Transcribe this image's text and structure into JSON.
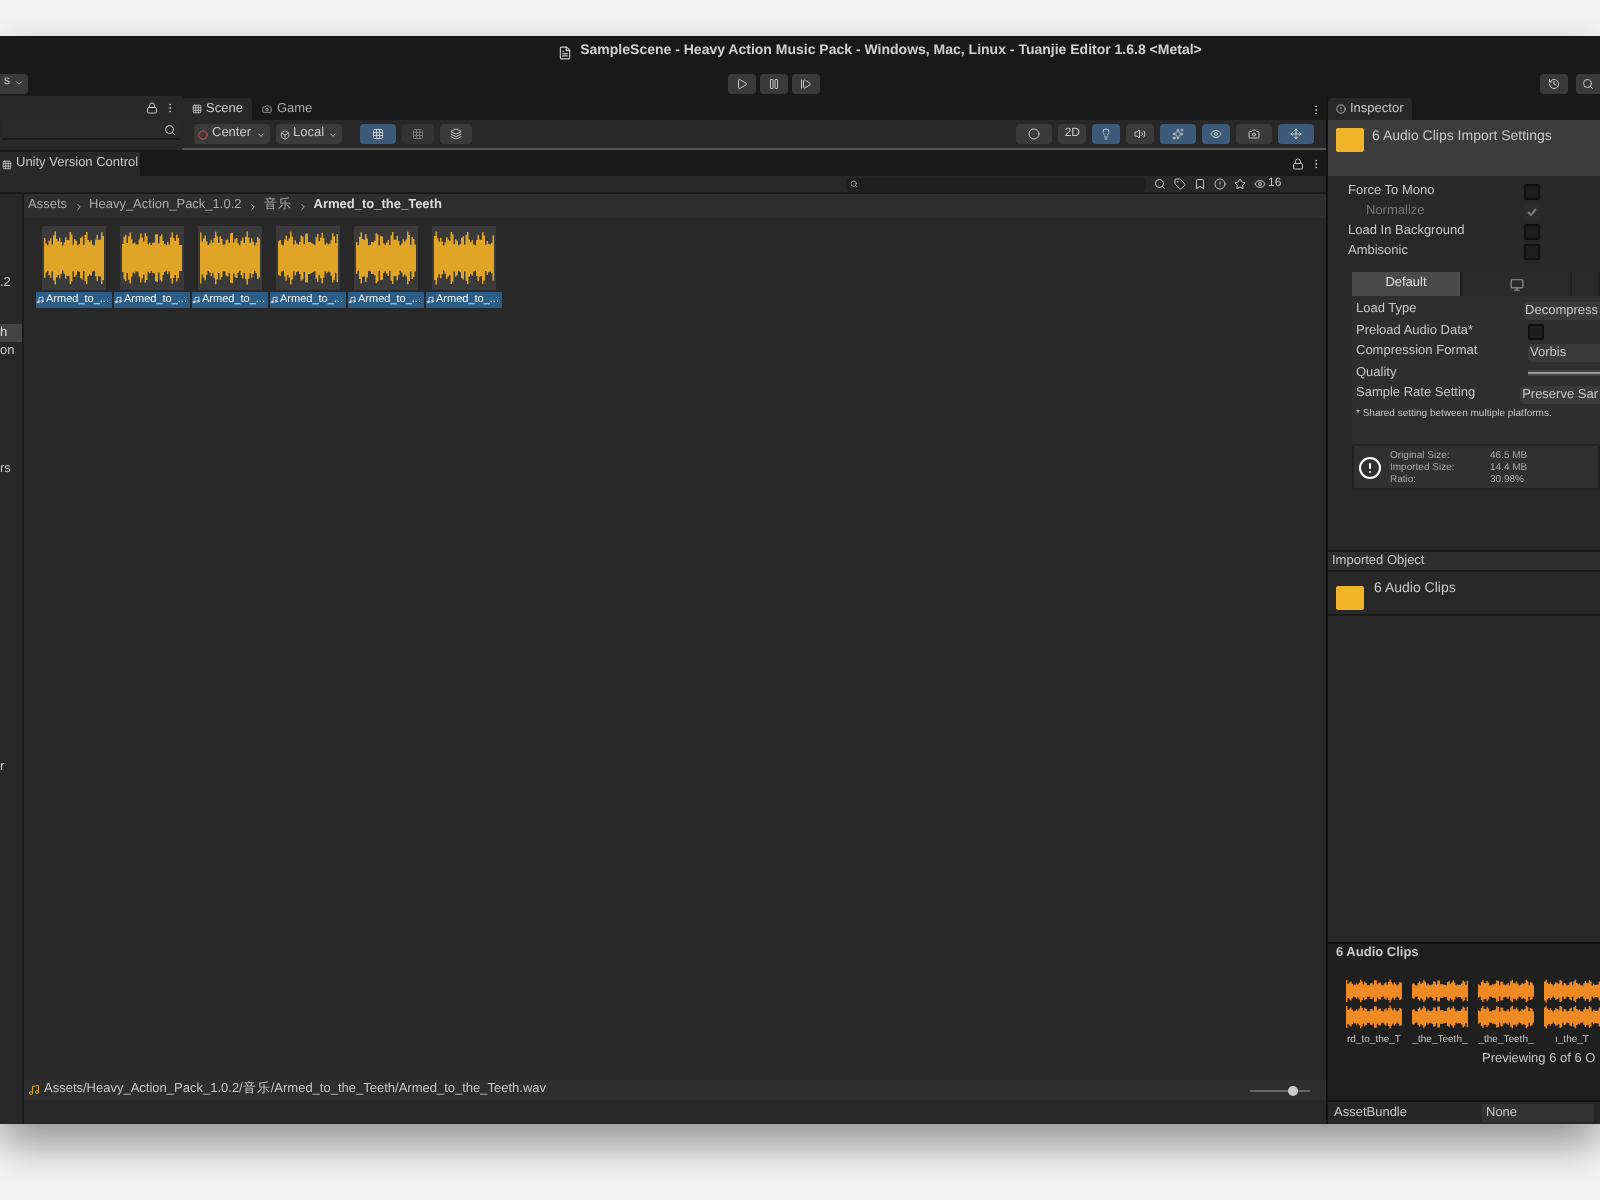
{
  "title_bar": {
    "title": "SampleScene - Heavy Action Music Pack - Windows, Mac, Linux - Tuanjie Editor 1.6.8 <Metal>"
  },
  "toolbar": {
    "layers_dropdown": "s"
  },
  "scene_view": {
    "tabs": [
      {
        "label": "Scene",
        "selected": true
      },
      {
        "label": "Game",
        "selected": false
      }
    ],
    "pivot_buttons": [
      "Center",
      "Local"
    ],
    "mode_2d": "2D"
  },
  "project": {
    "tab": "Unity Version Control",
    "hidden_count": "16",
    "folder_tree": [
      {
        "label": ".2",
        "selected": false
      },
      {
        "label": "h",
        "selected": true
      },
      {
        "label": "on",
        "selected": false
      },
      {
        "label": "rs",
        "selected": false
      },
      {
        "label": "r",
        "selected": false
      }
    ],
    "breadcrumb": [
      {
        "label": "Assets",
        "current": false
      },
      {
        "label": "Heavy_Action_Pack_1.0.2",
        "current": false
      },
      {
        "label": "音乐",
        "current": false
      },
      {
        "label": "Armed_to_the_Teeth",
        "current": true
      }
    ],
    "assets": [
      {
        "label": "Armed_to_...",
        "selected": true
      },
      {
        "label": "Armed_to_...",
        "selected": true
      },
      {
        "label": "Armed_to_...",
        "selected": true
      },
      {
        "label": "Armed_to_...",
        "selected": true
      },
      {
        "label": "Armed_to_...",
        "selected": true
      },
      {
        "label": "Armed_to_...",
        "selected": true
      }
    ],
    "status_path": "Assets/Heavy_Action_Pack_1.0.2/音乐/Armed_to_the_Teeth/Armed_to_the_Teeth.wav",
    "zoom_slider": {
      "level": 0.7
    }
  },
  "inspector": {
    "tab": "Inspector",
    "title": "6 Audio Clips Import Settings",
    "toggles": [
      {
        "label": "Force To Mono",
        "checked": false,
        "disabled": false
      },
      {
        "label": "Normalize",
        "checked": true,
        "disabled": true
      },
      {
        "label": "Load In Background",
        "checked": false,
        "disabled": false
      },
      {
        "label": "Ambisonic",
        "checked": false,
        "disabled": false
      }
    ],
    "platform_tabs": [
      {
        "kind": "text",
        "label": "Default",
        "selected": true
      },
      {
        "kind": "monitor",
        "selected": false
      },
      {
        "kind": "empty",
        "selected": false
      }
    ],
    "settings": [
      {
        "kind": "dropdown",
        "label": "Load Type",
        "value": "Decompress"
      },
      {
        "kind": "checkbox",
        "label": "Preload Audio Data*",
        "checked": false
      },
      {
        "kind": "dropdown",
        "label": "Compression Format",
        "value": "Vorbis"
      },
      {
        "kind": "slider",
        "label": "Quality",
        "level": 1
      },
      {
        "kind": "dropdown",
        "label": "Sample Rate Setting",
        "value": "Preserve Sar"
      }
    ],
    "note": "* Shared setting between multiple platforms.",
    "stats": [
      {
        "label": "Original Size:",
        "value": "46.5 MB"
      },
      {
        "label": "Imported Size:",
        "value": "14.4 MB"
      },
      {
        "label": "Ratio:",
        "value": "30.98%"
      }
    ],
    "imported_object": {
      "header": "Imported Object",
      "label": "6 Audio Clips"
    },
    "preview": {
      "header": "6 Audio Clips",
      "clips": [
        "rd_to_the_T",
        "_the_Teeth_",
        "_the_Teeth_",
        "ı_the_T"
      ],
      "caption": "Previewing 6 of 6 O"
    },
    "asset_bundle": {
      "label": "AssetBundle",
      "value": "None"
    }
  }
}
